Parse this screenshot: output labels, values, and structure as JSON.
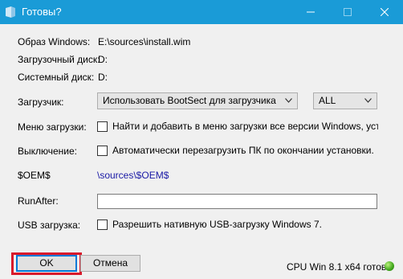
{
  "window": {
    "title": "Готовы?"
  },
  "fields": {
    "image": {
      "label": "Образ Windows:",
      "value": "E:\\sources\\install.wim"
    },
    "boot_disk": {
      "label": "Загрузочный диск:",
      "value": "D:"
    },
    "system_disk": {
      "label": "Системный диск:",
      "value": "D:"
    },
    "bootloader": {
      "label": "Загрузчик:",
      "selected": "Использовать BootSect для загрузчика",
      "target_selected": "ALL"
    },
    "boot_menu": {
      "label": "Меню загрузки:",
      "checkbox_label": "Найти и добавить в меню загрузки все версии Windows, установл",
      "checked": false
    },
    "shutdown": {
      "label": "Выключение:",
      "checkbox_label": "Автоматически перезагрузить ПК по окончании установки.",
      "checked": false
    },
    "oem": {
      "label": "$OEM$",
      "link": "\\sources\\$OEM$"
    },
    "runafter": {
      "label": "RunAfter:",
      "value": ""
    },
    "usb": {
      "label": "USB загрузка:",
      "checkbox_label": "Разрешить нативную USB-загрузку Windows 7.",
      "checked": false
    }
  },
  "buttons": {
    "ok": "OK",
    "cancel": "Отмена"
  },
  "status": {
    "text": "CPU Win 8.1 x64 готов",
    "indicator_color": "#3fa51b"
  },
  "colors": {
    "titlebar": "#1a9bd7",
    "link": "#1a1aa6",
    "focus_frame": "#d8192b",
    "accent": "#0078d7"
  }
}
